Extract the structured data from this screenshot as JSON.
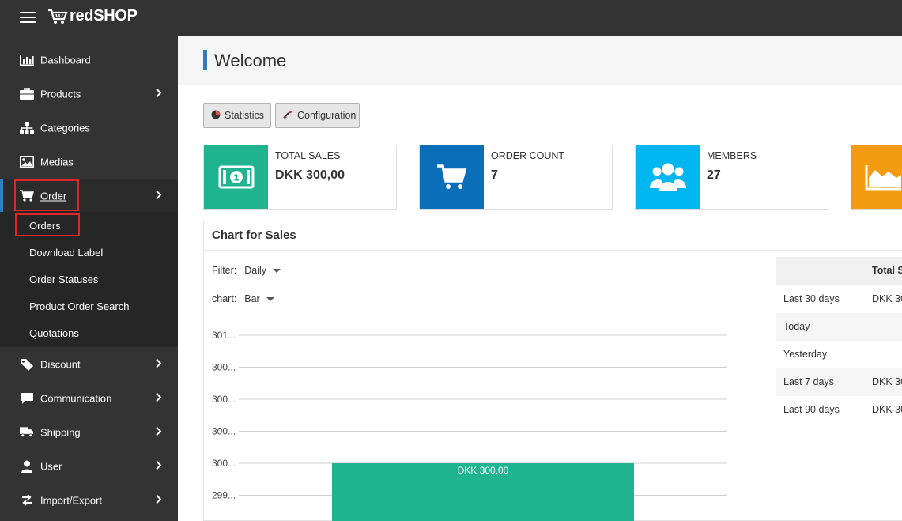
{
  "app": {
    "brand": "redSHOP"
  },
  "sidebar": {
    "items": [
      {
        "label": "Dashboard"
      },
      {
        "label": "Products"
      },
      {
        "label": "Categories"
      },
      {
        "label": "Medias"
      },
      {
        "label": "Order"
      },
      {
        "label": "Discount"
      },
      {
        "label": "Communication"
      },
      {
        "label": "Shipping"
      },
      {
        "label": "User"
      },
      {
        "label": "Import/Export"
      }
    ],
    "order_submenu": [
      {
        "label": "Orders"
      },
      {
        "label": "Download Label"
      },
      {
        "label": "Order Statuses"
      },
      {
        "label": "Product Order Search"
      },
      {
        "label": "Quotations"
      }
    ]
  },
  "page": {
    "title": "Welcome"
  },
  "toolbar": {
    "statistics_label": "Statistics",
    "configuration_label": "Configuration"
  },
  "cards": [
    {
      "label": "TOTAL SALES",
      "value": "DKK 300,00",
      "color": "#1fb390"
    },
    {
      "label": "ORDER COUNT",
      "value": "7",
      "color": "#0b6fb8"
    },
    {
      "label": "MEMBERS",
      "value": "27",
      "color": "#00b6f0"
    },
    {
      "label": "",
      "value": "",
      "color": "#f39c12"
    }
  ],
  "chart_panel": {
    "title": "Chart for Sales",
    "filter_label": "Filter:",
    "filter_value": "Daily",
    "chart_label": "chart:",
    "chart_value": "Bar"
  },
  "chart_data": {
    "type": "bar",
    "categories": [
      ""
    ],
    "values": [
      300
    ],
    "value_labels": [
      "DKK 300,00"
    ],
    "ytick_labels": [
      "301...",
      "300...",
      "300...",
      "300...",
      "300...",
      "299..."
    ],
    "bar_color": "#1fb390"
  },
  "summary": {
    "header": "Total S",
    "rows": [
      {
        "label": "Last 30 days",
        "value": "DKK 30"
      },
      {
        "label": "Today",
        "value": ""
      },
      {
        "label": "Yesterday",
        "value": ""
      },
      {
        "label": "Last 7 days",
        "value": "DKK 30"
      },
      {
        "label": "Last 90 days",
        "value": "DKK 30"
      }
    ]
  }
}
